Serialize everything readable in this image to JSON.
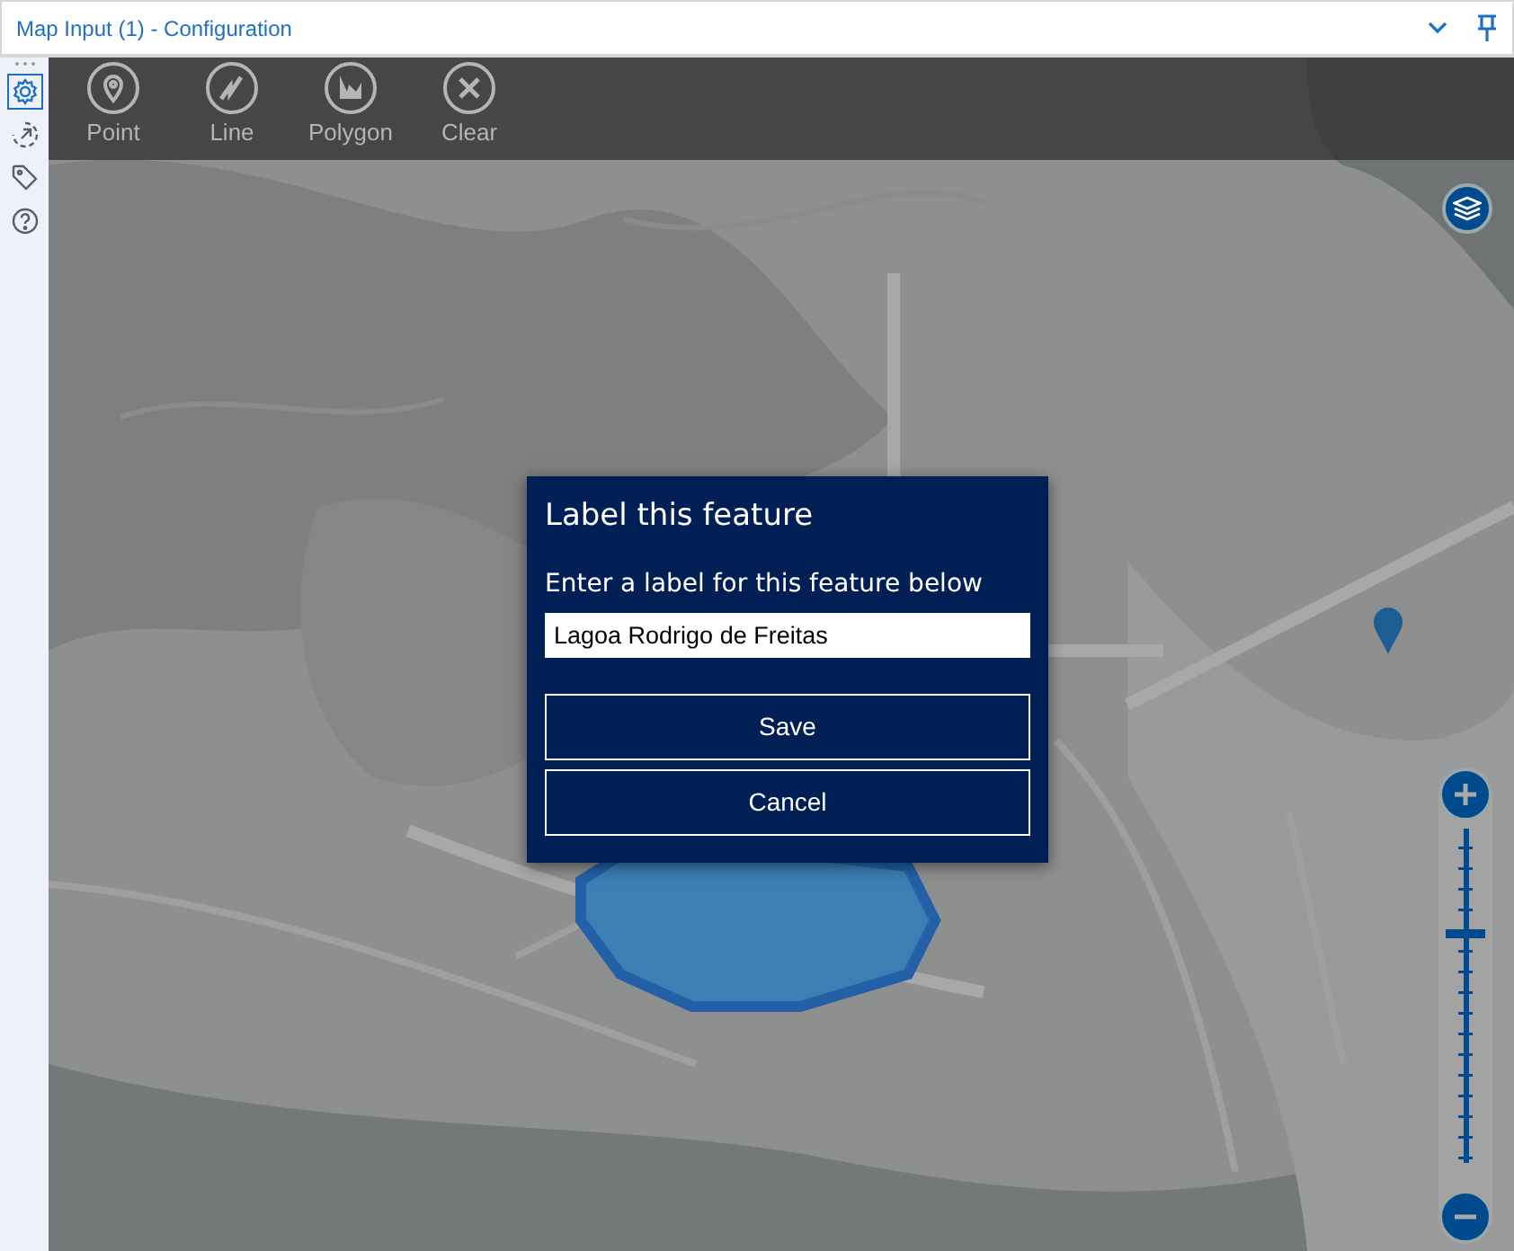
{
  "window": {
    "title": "Map Input (1) - Configuration"
  },
  "sidebar": {
    "items": [
      {
        "kind": "settings",
        "selected": true
      },
      {
        "kind": "target",
        "selected": false
      },
      {
        "kind": "tag",
        "selected": false
      },
      {
        "kind": "help",
        "selected": false
      }
    ]
  },
  "toolbar": {
    "tools": [
      {
        "kind": "point",
        "label": "Point"
      },
      {
        "kind": "line",
        "label": "Line"
      },
      {
        "kind": "polygon",
        "label": "Polygon"
      },
      {
        "kind": "clear",
        "label": "Clear"
      }
    ]
  },
  "zoom": {
    "level": 0.69
  },
  "dialog": {
    "title": "Label this feature",
    "prompt": "Enter a label for this feature below",
    "field": {
      "value": "Lagoa Rodrigo de Freitas"
    },
    "buttons": [
      "Save",
      "Cancel"
    ]
  }
}
